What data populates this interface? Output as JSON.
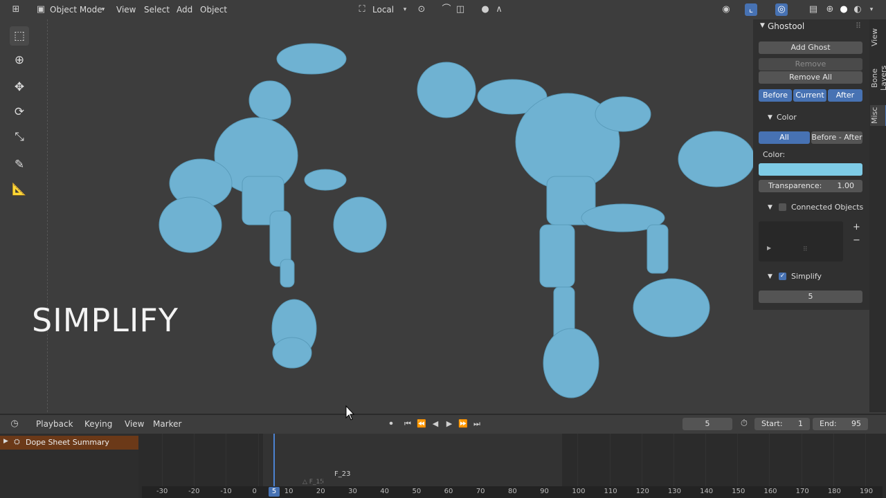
{
  "header": {
    "mode": "Object Mode",
    "menus": [
      "View",
      "Select",
      "Add",
      "Object"
    ],
    "transform_orientation": "Local"
  },
  "overlay_text": "SIMPLIFY",
  "npanel": {
    "title": "Ghostool",
    "add_ghost": "Add Ghost",
    "remove": "Remove",
    "remove_all": "Remove All",
    "range_buttons": [
      "Before",
      "Current",
      "After"
    ],
    "color_section": "Color",
    "color_mode_buttons": [
      "All",
      "Before - After"
    ],
    "color_label": "Color:",
    "ghost_color": "#7ecbe6",
    "transparence_label": "Transparence:",
    "transparence_value": "1.00",
    "connected_objects": "Connected Objects",
    "simplify_label": "Simplify",
    "simplify_value": "5",
    "tabs": [
      "View",
      "Bone Layers",
      "Misc"
    ]
  },
  "timeline": {
    "menus": [
      "Playback",
      "Keying",
      "View",
      "Marker"
    ],
    "current_frame": "5",
    "start_label": "Start:",
    "start_value": "1",
    "end_label": "End:",
    "end_value": "95",
    "dope_summary": "Dope Sheet Summary",
    "marker1": "F_23",
    "marker2": "F_15",
    "ruler_ticks": [
      "-30",
      "-20",
      "-10",
      "0",
      "10",
      "20",
      "30",
      "40",
      "50",
      "60",
      "70",
      "80",
      "90",
      "100",
      "110",
      "120",
      "130",
      "140",
      "150",
      "160",
      "170",
      "180",
      "190"
    ],
    "frame_indicator": "5"
  },
  "colors": {
    "accent": "#4772b3",
    "mesh": "#6fb2d2",
    "summary": "#6b3918"
  }
}
